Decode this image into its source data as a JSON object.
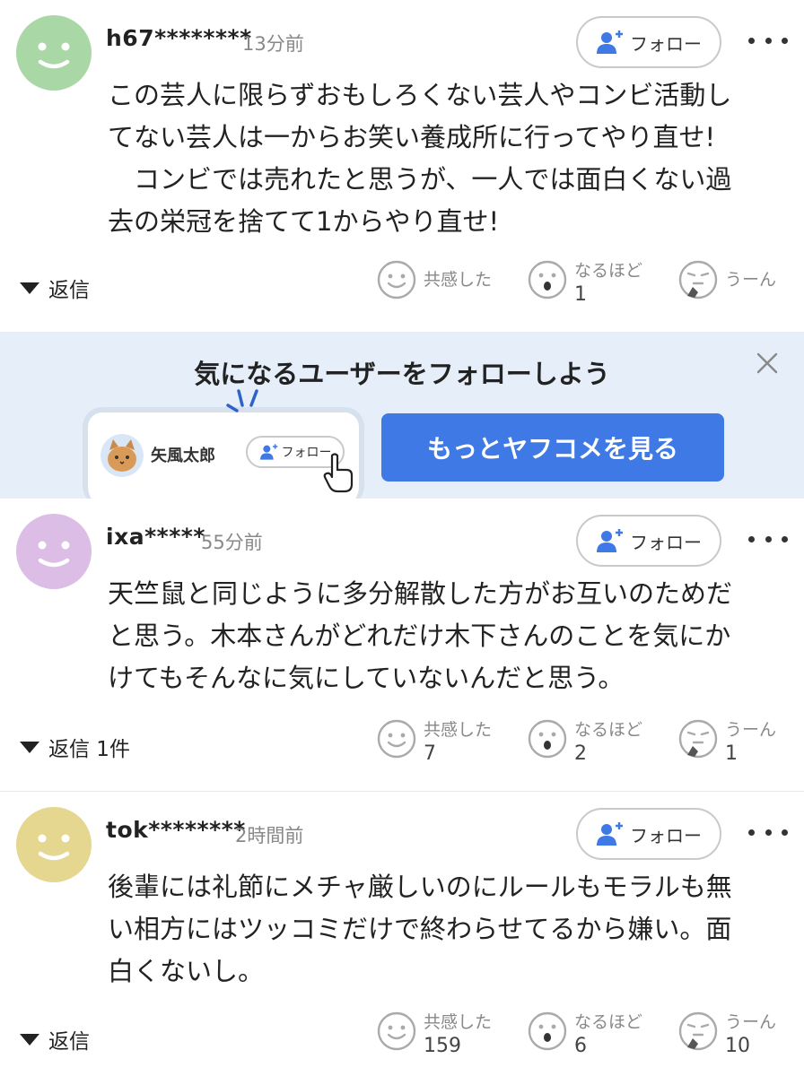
{
  "comments": [
    {
      "username": "h67********",
      "time": "13分前",
      "follow_label": "フォロー",
      "text": "この芸人に限らずおもしろくない芸人やコンビ活動し\nてない芸人は一からお笑い養成所に行ってやり直せ!\n　コンビでは売れたと思うが、一人では面白くない過\n去の栄冠を捨てて1からやり直せ!",
      "reply_label": "返信",
      "avatar_color": "#a9d8a6",
      "reactions": [
        {
          "label": "共感した",
          "count": ""
        },
        {
          "label": "なるほど",
          "count": "1"
        },
        {
          "label": "うーん",
          "count": ""
        }
      ]
    },
    {
      "username": "ixa*****",
      "time": "55分前",
      "follow_label": "フォロー",
      "text": "天竺鼠と同じように多分解散した方がお互いのためだ\nと思う。木本さんがどれだけ木下さんのことを気にか\nけてもそんなに気にしていないんだと思う。",
      "reply_label": "返信 1件",
      "avatar_color": "#dcbde6",
      "reactions": [
        {
          "label": "共感した",
          "count": "7"
        },
        {
          "label": "なるほど",
          "count": "2"
        },
        {
          "label": "うーん",
          "count": "1"
        }
      ]
    },
    {
      "username": "tok********",
      "time": "2時間前",
      "follow_label": "フォロー",
      "text": "後輩には礼節にメチャ厳しいのにルールもモラルも無\nい相方にはツッコミだけで終わらせてるから嫌い。面\n白くないし。",
      "reply_label": "返信",
      "avatar_color": "#e5d690",
      "reactions": [
        {
          "label": "共感した",
          "count": "159"
        },
        {
          "label": "なるほど",
          "count": "6"
        },
        {
          "label": "うーん",
          "count": "10"
        }
      ]
    }
  ],
  "promo": {
    "title": "気になるユーザーをフォローしよう",
    "sample_user": "矢風太郎",
    "sample_follow": "フォロー",
    "cta": "もっとヤフコメを見る",
    "accent": "#3e79e6",
    "background": "#e6eef9"
  },
  "icons": {
    "follow": "person-plus-icon",
    "more": "more-dots-icon",
    "reply": "caret-down-icon",
    "reaction_1": "smile-face-icon",
    "reaction_2": "surprised-face-icon",
    "reaction_3": "thinking-face-icon",
    "close": "close-icon"
  }
}
